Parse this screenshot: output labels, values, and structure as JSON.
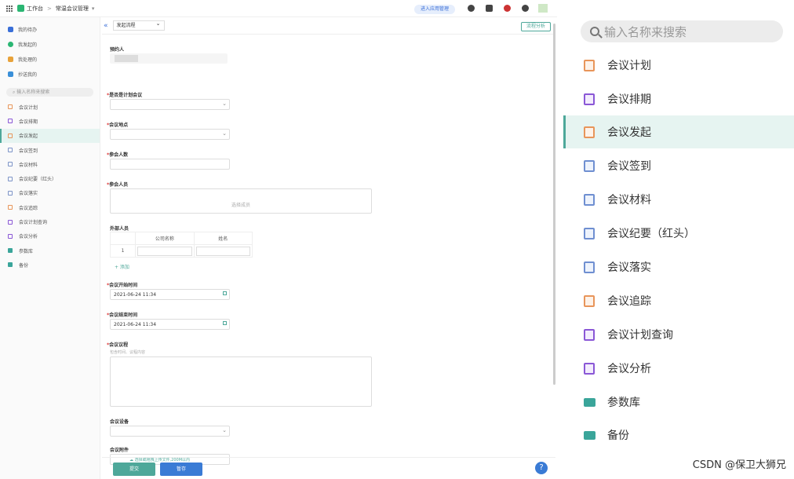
{
  "topbar": {
    "workspace": "工作台",
    "separator": ">",
    "app_name": "常温会议管理",
    "enter_app_btn": "进入应用管理"
  },
  "sidenav": {
    "top_items": [
      {
        "label": "我的待办",
        "color": "#3a6fd8"
      },
      {
        "label": "我发起的",
        "color": "#2bb673"
      },
      {
        "label": "我处理的",
        "color": "#e8a23a"
      },
      {
        "label": "抄送我的",
        "color": "#3a8fd8"
      }
    ],
    "search_placeholder": "输入名称来搜索",
    "items": [
      {
        "label": "会议计划"
      },
      {
        "label": "会议排期"
      },
      {
        "label": "会议发起"
      },
      {
        "label": "会议签到"
      },
      {
        "label": "会议材料"
      },
      {
        "label": "会议纪要（红头）"
      },
      {
        "label": "会议落实"
      },
      {
        "label": "会议追踪"
      },
      {
        "label": "会议计划查询"
      },
      {
        "label": "会议分析"
      },
      {
        "label": "参数库"
      },
      {
        "label": "备份"
      }
    ]
  },
  "content": {
    "collapse_icon": "«",
    "process_select": "发起流程",
    "analyze_btn": "流程分析",
    "form": {
      "initiator_label": "预约人",
      "plan_label": "是否是计划会议",
      "location_label": "会议地点",
      "count_label": "参会人数",
      "attendees_label": "参会人员",
      "attendees_placeholder": "选择成员",
      "external_label": "外部人员",
      "ext_col_company": "公司名称",
      "ext_col_name": "姓名",
      "ext_row_index": "1",
      "add_link": "+ 添加",
      "start_label": "会议开始时间",
      "start_value": "2021-06-24 11:34",
      "end_label": "会议结束时间",
      "end_value": "2021-06-24 11:34",
      "agenda_label": "会议议程",
      "agenda_hint": "包含时间、议程内容",
      "equipment_label": "会议设备",
      "attachment_label": "会议附件",
      "attachment_hint": "选择或拖拽上传文件,200M以内"
    },
    "submit_btn": "提交",
    "save_btn": "暂存",
    "help_icon": "?"
  },
  "right_panel": {
    "search_placeholder": "输入名称来搜索",
    "items": [
      {
        "label": "会议计划",
        "icon": "orange"
      },
      {
        "label": "会议排期",
        "icon": "purple"
      },
      {
        "label": "会议发起",
        "icon": "orange"
      },
      {
        "label": "会议签到",
        "icon": "blue"
      },
      {
        "label": "会议材料",
        "icon": "blue"
      },
      {
        "label": "会议纪要（红头）",
        "icon": "blue"
      },
      {
        "label": "会议落实",
        "icon": "blue"
      },
      {
        "label": "会议追踪",
        "icon": "orange"
      },
      {
        "label": "会议计划查询",
        "icon": "purple"
      },
      {
        "label": "会议分析",
        "icon": "purple"
      },
      {
        "label": "参数库",
        "icon": "folder"
      },
      {
        "label": "备份",
        "icon": "folder"
      }
    ],
    "watermark": "CSDN @保卫大狮兄"
  }
}
